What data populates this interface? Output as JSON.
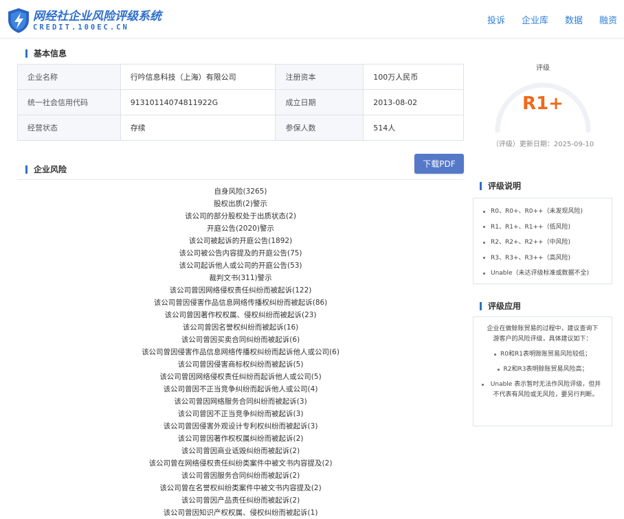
{
  "header": {
    "logo_cn": "网经社企业风险评级系统",
    "logo_en": "CREDIT.100EC.CN",
    "nav": [
      "投诉",
      "企业库",
      "数据",
      "融资"
    ]
  },
  "basic": {
    "title": "基本信息",
    "rows": [
      [
        "企业名称",
        "行吟信息科技（上海）有限公司",
        "注册资本",
        "100万人民币"
      ],
      [
        "统一社会信用代码",
        "91310114074811922G",
        "成立日期",
        "2013-08-02"
      ],
      [
        "经营状态",
        "存续",
        "参保人数",
        "514人"
      ]
    ]
  },
  "rating": {
    "label": "评级",
    "grade": "R1+",
    "date": "（评级）更新日期：2025-09-10",
    "color": "#f06a1a"
  },
  "risk": {
    "title": "企业风险",
    "pdf_button": "下载PDF",
    "items": [
      "自身风险(3265)",
      "股权出质(2)警示",
      "该公司的部分股权处于出质状态(2)",
      "开庭公告(2020)警示",
      "该公司被起诉的开庭公告(1892)",
      "该公司被公告内容提及的开庭公告(75)",
      "该公司起诉他人或公司的开庭公告(53)",
      "裁判文书(311)警示",
      "该公司曾因网络侵权责任纠纷而被起诉(122)",
      "该公司曾因侵害作品信息网络传播权纠纷而被起诉(86)",
      "该公司曾因著作权权属、侵权纠纷而被起诉(23)",
      "该公司曾因名誉权纠纷而被起诉(16)",
      "该公司曾因买卖合同纠纷而被起诉(6)",
      "该公司曾因侵害作品信息网络传播权纠纷而起诉他人或公司(6)",
      "该公司曾因侵害商标权纠纷而被起诉(5)",
      "该公司曾因网络侵权责任纠纷而起诉他人或公司(5)",
      "该公司曾因不正当竞争纠纷而起诉他人或公司(4)",
      "该公司曾因网络服务合同纠纷而被起诉(3)",
      "该公司曾因不正当竞争纠纷而被起诉(3)",
      "该公司曾因侵害外观设计专利权纠纷而被起诉(3)",
      "该公司曾因著作权权属纠纷而被起诉(2)",
      "该公司曾因商业诋毁纠纷而被起诉(2)",
      "该公司曾在网络侵权责任纠纷类案件中被文书内容提及(2)",
      "该公司曾因服务合同纠纷而被起诉(2)",
      "该公司曾在名誉权纠纷类案件中被文书内容提及(2)",
      "该公司曾因产品责任纠纷而被起诉(2)",
      "该公司曾因知识产权权属、侵权纠纷而被起诉(1)"
    ]
  },
  "legend": {
    "title": "评级说明",
    "items": [
      "R0、R0+、R0++（未发现风险)",
      "R1、R1+、R1++（低风险)",
      "R2、R2+、R2++（中风险)",
      "R3、R3+、R3++（高风险)",
      "Unable（未达评级标准或数据不全)"
    ]
  },
  "application": {
    "title": "评级应用",
    "intro": "企业在做赊账贸易的过程中，建议查询下游客户的风险评级，具体建议如下：",
    "items": [
      "R0和R1表明赊账贸易风险较低；",
      "R2和R3表明赊账贸易风险高；",
      "Unable 表示暂时无法作风险评级，但并不代表有风险或无风险，要另行判断。"
    ]
  }
}
